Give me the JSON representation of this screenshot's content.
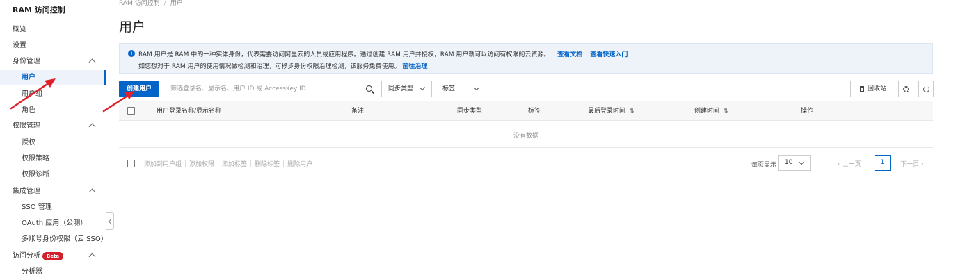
{
  "sidebar": {
    "title": "RAM 访问控制",
    "items": [
      {
        "label": "概览"
      },
      {
        "label": "设置"
      },
      {
        "label": "身份管理"
      },
      {
        "label": "用户"
      },
      {
        "label": "用户组"
      },
      {
        "label": "角色"
      },
      {
        "label": "权限管理"
      },
      {
        "label": "授权"
      },
      {
        "label": "权限策略"
      },
      {
        "label": "权限诊断"
      },
      {
        "label": "集成管理"
      },
      {
        "label": "SSO 管理"
      },
      {
        "label": "OAuth 应用（公测）"
      },
      {
        "label": "多账号身份权限（云 SSO）"
      },
      {
        "label": "访问分析"
      },
      {
        "label": "分析器"
      }
    ],
    "beta_badge": "Beta"
  },
  "breadcrumb": {
    "items": [
      "RAM 访问控制",
      "用户"
    ],
    "separator": "/"
  },
  "page_title": "用户",
  "info": {
    "line1": "RAM 用户是 RAM 中的一种实体身份，代表需要访问阿里云的人员或应用程序。通过创建 RAM 用户并授权，RAM 用户就可以访问有权限的云资源。",
    "link_docs": "查看文档",
    "link_quickstart": "查看快速入门",
    "line2": "如您想对于 RAM 用户的使用情况做检测和治理，可移步身份权限治理检测，该服务免费使用。",
    "link_govern": "前往治理"
  },
  "toolbar": {
    "create_label": "创建用户",
    "search_placeholder": "筛选登录名、显示名、用户 ID 或 AccessKey ID",
    "sync_type": "同步类型",
    "tag": "标签",
    "recycle_label": "回收站"
  },
  "table": {
    "columns": [
      "用户登录名称/显示名称",
      "备注",
      "同步类型",
      "标签",
      "最后登录时间",
      "创建时间",
      "操作"
    ],
    "sort_symbol": "⇅",
    "empty_text": "没有数据"
  },
  "footer": {
    "batch_actions": [
      "添加到用户组",
      "添加权限",
      "添加标签",
      "删除标签",
      "删除用户"
    ],
    "per_page_label": "每页显示",
    "per_page_value": "10",
    "prev_label": "上一页",
    "current_page": "1",
    "next_label": "下一页"
  },
  "colors": {
    "primary": "#0064c8",
    "beta": "#d2202c",
    "annotation_arrow": "#e0202a"
  },
  "icons": [
    "info-icon",
    "search-icon",
    "chevron-down-icon",
    "trash-icon",
    "gear-icon",
    "refresh-icon",
    "sort-icon",
    "chevron-left-icon",
    "chevron-right-icon",
    "arrow-annotation"
  ]
}
